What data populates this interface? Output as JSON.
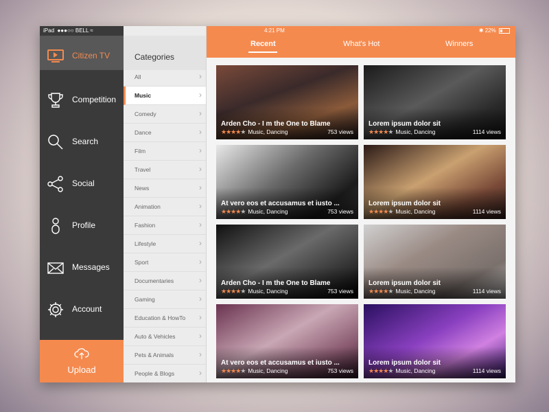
{
  "status": {
    "device": "iPad",
    "carrier": "●●●○○ BELL",
    "time": "4:21 PM",
    "battery": "22%"
  },
  "nav": {
    "brand": "Citizen TV",
    "items": [
      {
        "label": "Competition",
        "icon": "trophy-icon"
      },
      {
        "label": "Search",
        "icon": "search-icon"
      },
      {
        "label": "Social",
        "icon": "share-icon"
      },
      {
        "label": "Profile",
        "icon": "profile-icon"
      },
      {
        "label": "Messages",
        "icon": "mail-icon"
      },
      {
        "label": "Account",
        "icon": "gear-icon"
      }
    ],
    "upload": "Upload"
  },
  "categories": {
    "title": "Categories",
    "items": [
      "All",
      "Music",
      "Comedy",
      "Dance",
      "Film",
      "Travel",
      "News",
      "Animation",
      "Fashion",
      "Lifestyle",
      "Sport",
      "Documentaries",
      "Gaming",
      "Education & HowTo",
      "Auto & Vehicles",
      "Pets & Animals",
      "People & Blogs"
    ],
    "active": "Music"
  },
  "tabs": [
    "Recent",
    "What's Hot",
    "Winners"
  ],
  "videos": [
    {
      "title": "Arden Cho - I m the One to Blame",
      "rating": 4,
      "genre": "Music, Dancing",
      "views": "753 views"
    },
    {
      "title": "Lorem ipsum dolor sit",
      "rating": 4,
      "genre": "Music, Dancing",
      "views": "1114 views"
    },
    {
      "title": "At vero eos et accusamus et iusto ...",
      "rating": 4,
      "genre": "Music, Dancing",
      "views": "753 views"
    },
    {
      "title": "Lorem ipsum dolor sit",
      "rating": 4,
      "genre": "Music, Dancing",
      "views": "1114 views"
    },
    {
      "title": "Arden Cho - I m the One to Blame",
      "rating": 4,
      "genre": "Music, Dancing",
      "views": "753 views"
    },
    {
      "title": "Lorem ipsum dolor sit",
      "rating": 4,
      "genre": "Music, Dancing",
      "views": "1114 views"
    },
    {
      "title": "At vero eos et accusamus et iusto ...",
      "rating": 4,
      "genre": "Music, Dancing",
      "views": "753 views"
    },
    {
      "title": "Lorem ipsum dolor sit",
      "rating": 4,
      "genre": "Music, Dancing",
      "views": "1114 views"
    }
  ],
  "colors": {
    "accent": "#f58a4f",
    "nav_bg": "#3a3a3a",
    "nav_brand_bg": "#585858"
  }
}
